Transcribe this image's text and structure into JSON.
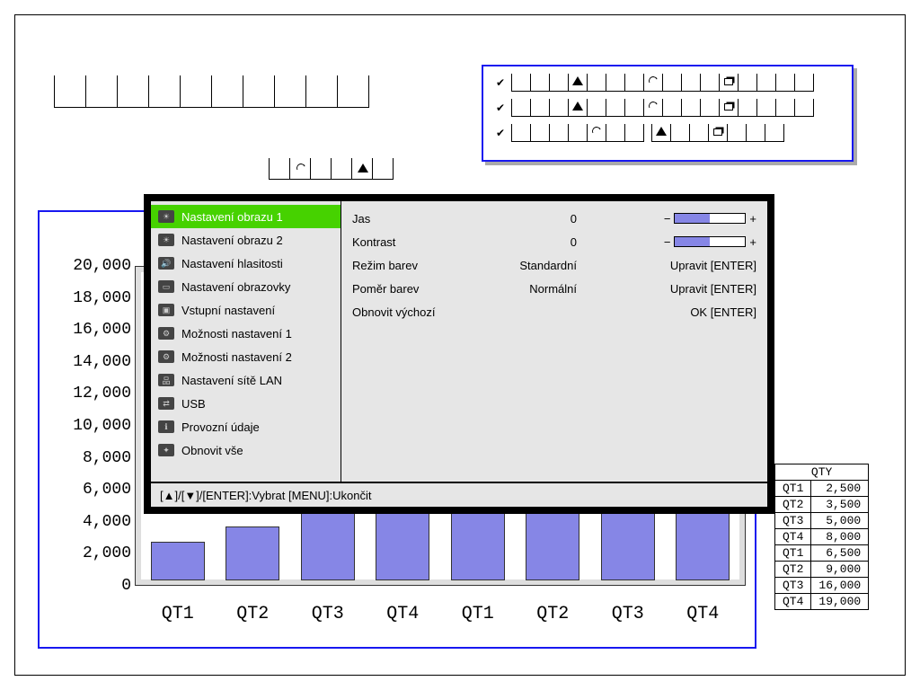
{
  "chart_data": {
    "type": "bar",
    "categories": [
      "QT1",
      "QT2",
      "QT3",
      "QT4",
      "QT1",
      "QT2",
      "QT3",
      "QT4"
    ],
    "values": [
      2500,
      3500,
      5000,
      8000,
      6500,
      9000,
      16000,
      19000
    ],
    "ylim": [
      0,
      20000
    ],
    "y_ticks": [
      0,
      2000,
      4000,
      6000,
      8000,
      10000,
      12000,
      14000,
      16000,
      18000,
      20000
    ],
    "y_tick_labels": [
      "0",
      "2,000",
      "4,000",
      "6,000",
      "8,000",
      "10,000",
      "12,000",
      "14,000",
      "16,000",
      "18,000",
      "20,000"
    ],
    "title": "",
    "xlabel": "",
    "ylabel": ""
  },
  "qty_table": {
    "header": "QTY",
    "rows": [
      {
        "label": "QT1",
        "value": "2,500"
      },
      {
        "label": "QT2",
        "value": "3,500"
      },
      {
        "label": "QT3",
        "value": "5,000"
      },
      {
        "label": "QT4",
        "value": "8,000"
      },
      {
        "label": "QT1",
        "value": "6,500"
      },
      {
        "label": "QT2",
        "value": "9,000"
      },
      {
        "label": "QT3",
        "value": "16,000"
      },
      {
        "label": "QT4",
        "value": "19,000"
      }
    ]
  },
  "osd": {
    "menu": [
      "Nastavení obrazu 1",
      "Nastavení obrazu 2",
      "Nastavení hlasitosti",
      "Nastavení obrazovky",
      "Vstupní nastavení",
      "Možnosti nastavení 1",
      "Možnosti nastavení 2",
      "Nastavení sítě LAN",
      "USB",
      "Provozní údaje",
      "Obnovit vše"
    ],
    "menu_icons": [
      "☀",
      "☀",
      "🔊",
      "▭",
      "▣",
      "⚙",
      "⚙",
      "品",
      "⇄",
      "ℹ",
      "✦"
    ],
    "selected_index": 0,
    "settings": {
      "brightness": {
        "label": "Jas",
        "value": "0",
        "minus": "−",
        "plus": "+",
        "fill": 0.5
      },
      "contrast": {
        "label": "Kontrast",
        "value": "0",
        "minus": "−",
        "plus": "+",
        "fill": 0.5
      },
      "color_mode": {
        "label": "Režim barev",
        "value": "Standardní",
        "action": "Upravit [ENTER]"
      },
      "color_rat": {
        "label": "Poměr barev",
        "value": "Normální",
        "action": "Upravit [ENTER]"
      },
      "reset": {
        "label": "Obnovit výchozí",
        "action": "OK [ENTER]"
      }
    },
    "footer": "[▲]/[▼]/[ENTER]:Vybrat  [MENU]:Ukončit"
  }
}
